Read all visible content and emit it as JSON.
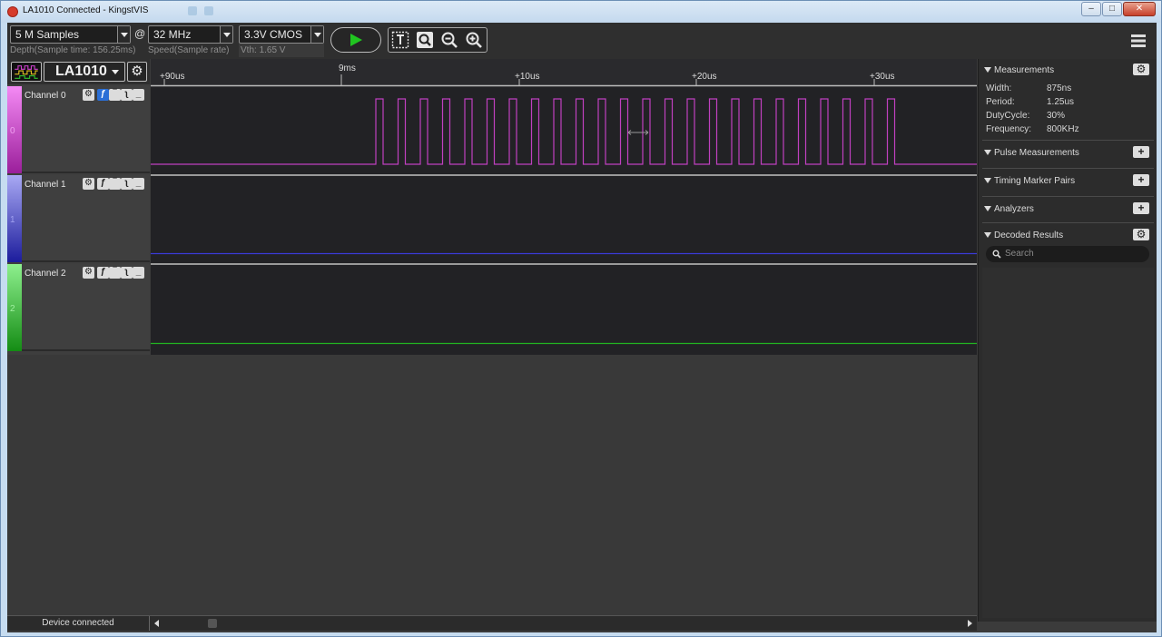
{
  "window": {
    "title": "LA1010 Connected - KingstVIS",
    "controls": {
      "minimize": "–",
      "maximize": "□",
      "close": "✕"
    }
  },
  "toolbar": {
    "depth": {
      "value": "5 M Samples",
      "caption": "Depth(Sample time: 156.25ms)"
    },
    "at": "@",
    "speed": {
      "value": "32 MHz",
      "caption": "Speed(Sample rate)"
    },
    "threshold": {
      "value": "3.3V CMOS",
      "caption": "Vth: 1.65 V"
    }
  },
  "device": {
    "name": "LA1010"
  },
  "timeline": {
    "top_label": "9ms",
    "ticks": [
      "+90us",
      "+10us",
      "+20us",
      "+30us"
    ]
  },
  "channels": [
    {
      "label": "Channel 0",
      "index": "0",
      "color": "#c040c0"
    },
    {
      "label": "Channel 1",
      "index": "1",
      "color": "#3b3bd8"
    },
    {
      "label": "Channel 2",
      "index": "2",
      "color": "#22b422"
    }
  ],
  "right_panel": {
    "measurements": {
      "title": "Measurements",
      "items": [
        {
          "key": "Width:",
          "value": "875ns"
        },
        {
          "key": "Period:",
          "value": "1.25us"
        },
        {
          "key": "DutyCycle:",
          "value": "30%"
        },
        {
          "key": "Frequency:",
          "value": "800KHz"
        }
      ]
    },
    "pulse_measurements": "Pulse Measurements",
    "timing_marker_pairs": "Timing Marker Pairs",
    "analyzers": "Analyzers",
    "decoded_results": "Decoded Results",
    "search_placeholder": "Search"
  },
  "status": {
    "text": "Device connected"
  },
  "colors": {
    "background": "#3b3b3b",
    "plot": "#222225",
    "run_green": "#20c520"
  }
}
